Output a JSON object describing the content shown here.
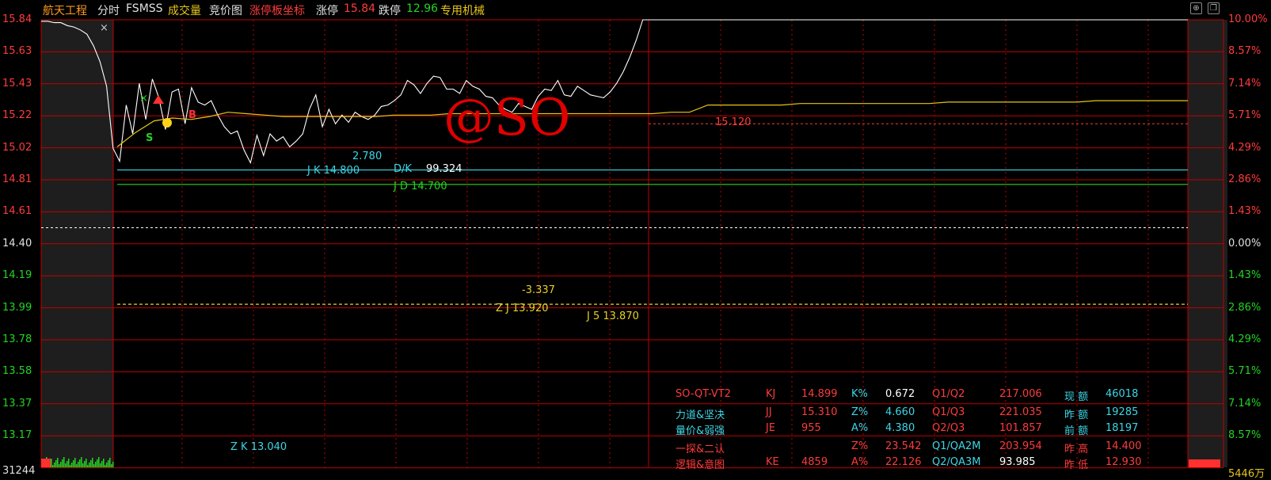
{
  "header": {
    "stock_name": "航天工程",
    "tab_fenshi": "分时",
    "indicator": "FSMSS",
    "volume_label": "成交量",
    "bid_chart": "竞价图",
    "limit_coord": "涨停板坐标",
    "limit_up_label": "涨停",
    "limit_up_value": "15.84",
    "limit_down_label": "跌停",
    "limit_down_value": "12.96",
    "industry": "专用机械"
  },
  "axis": {
    "left_ticks": [
      "15.84",
      "15.63",
      "15.43",
      "15.22",
      "15.02",
      "14.81",
      "14.61",
      "14.40",
      "14.19",
      "13.99",
      "13.78",
      "13.58",
      "13.37",
      "13.17"
    ],
    "right_ticks": [
      "10.00%",
      "8.57%",
      "7.14%",
      "5.71%",
      "4.29%",
      "2.86%",
      "1.43%",
      "0.00%",
      "1.43%",
      "2.86%",
      "4.29%",
      "5.71%",
      "7.14%",
      "8.57%"
    ],
    "volume_left": "31244",
    "volume_right": "5446万"
  },
  "annotations": {
    "level_15120": "15.120",
    "jk_diff": "2.780",
    "jk": "J K     14.800",
    "dk_label": "D/K",
    "dk_value": "99.324",
    "jd": "J D   14.700",
    "zj_diff": "-3.337",
    "zj": "Z J   13.920",
    "j5": "J 5   13.870",
    "zk": "Z K  13.040",
    "watermark": "@SO",
    "close_mark": "×"
  },
  "info_table": {
    "rows": [
      {
        "c1": "SO-QT-VT2",
        "k1": "KJ",
        "v1": "14.899",
        "k2": "K%",
        "v2": "0.672",
        "k3": "Q1/Q2",
        "v3": "217.006",
        "k4": "现 额",
        "v4": "46018"
      },
      {
        "c1": "力道&坚决",
        "k1": "JJ",
        "v1": "15.310",
        "k2": "Z%",
        "v2": "4.660",
        "k3": "Q1/Q3",
        "v3": "221.035",
        "k4": "昨 额",
        "v4": "19285"
      },
      {
        "c1": "量价&弱强",
        "k1": "JE",
        "v1": "955",
        "k2": "A%",
        "v2": "4.380",
        "k3": "Q2/Q3",
        "v3": "101.857",
        "k4": "前 额",
        "v4": "18197"
      },
      {
        "c1": "一探&二认",
        "k1": "",
        "v1": "",
        "k2": "Z%",
        "v2": "23.542",
        "k3": "Q1/QA2M",
        "v3": "203.954",
        "k4": "昨 高",
        "v4": "14.400"
      },
      {
        "c1": "逻辑&意图",
        "k1": "KE",
        "v1": "4859",
        "k2": "A%",
        "v2": "22.126",
        "k3": "Q2/QA3M",
        "v3": "93.985",
        "k4": "昨 低",
        "v4": "12.930"
      }
    ]
  },
  "colors": {
    "background": "#000000",
    "grid_red": "#c00000",
    "price_line": "#ffffff",
    "avg_line": "#e6c619",
    "cyan": "#3cd6e6",
    "green": "#22d422",
    "yellow": "#e6d02a",
    "red_text": "#ff3b3b",
    "orange": "#ff9a1f"
  },
  "chart_data": {
    "type": "line",
    "title": "",
    "ylim": [
      12.96,
      15.84
    ],
    "prev_close": 14.4,
    "series": [
      {
        "values": [
          15.83,
          15.83,
          15.82,
          15.82,
          15.8,
          15.79,
          15.77,
          15.74,
          15.66,
          15.55,
          15.38,
          14.95,
          14.86,
          15.25,
          15.05,
          15.4,
          15.15,
          15.43,
          15.3,
          15.08,
          15.34,
          15.36,
          15.12,
          15.37,
          15.27,
          15.25,
          15.28,
          15.18,
          15.1,
          15.05,
          15.07,
          14.94,
          14.85,
          15.04,
          14.9,
          15.05,
          15.0,
          15.03,
          14.96,
          15.0,
          15.05,
          15.22,
          15.32,
          15.1,
          15.22,
          15.12,
          15.18,
          15.13,
          15.2,
          15.17,
          15.15,
          15.18,
          15.24,
          15.25,
          15.28,
          15.32,
          15.42,
          15.39,
          15.33,
          15.4,
          15.45,
          15.44,
          15.36,
          15.36,
          15.33,
          15.42,
          15.38,
          15.36,
          15.31,
          15.3,
          15.25,
          15.22,
          15.2,
          15.26,
          15.24,
          15.22,
          15.31,
          15.36,
          15.35,
          15.42,
          15.32,
          15.31,
          15.38,
          15.35,
          15.32,
          15.31,
          15.3,
          15.34,
          15.4,
          15.48,
          15.58,
          15.7,
          15.84,
          15.84
        ]
      },
      {
        "values": [
          14.96,
          15.06,
          15.14,
          15.16,
          15.15,
          15.17,
          15.2,
          15.19,
          15.18,
          15.17,
          15.17,
          15.17,
          15.17,
          15.17,
          15.17,
          15.18,
          15.18,
          15.18,
          15.19,
          15.19,
          15.19,
          15.19,
          15.19,
          15.19,
          15.19,
          15.19,
          15.19,
          15.19,
          15.19,
          15.19,
          15.2,
          15.2,
          15.25,
          15.25,
          15.25,
          15.25,
          15.25,
          15.26,
          15.26,
          15.26,
          15.26,
          15.26,
          15.26,
          15.26,
          15.26,
          15.27,
          15.27,
          15.27,
          15.27,
          15.27,
          15.27,
          15.27,
          15.27,
          15.28,
          15.28,
          15.28,
          15.28,
          15.28,
          15.28
        ]
      }
    ],
    "levels": [
      15.12,
      14.8,
      14.7,
      14.4,
      13.87
    ]
  }
}
